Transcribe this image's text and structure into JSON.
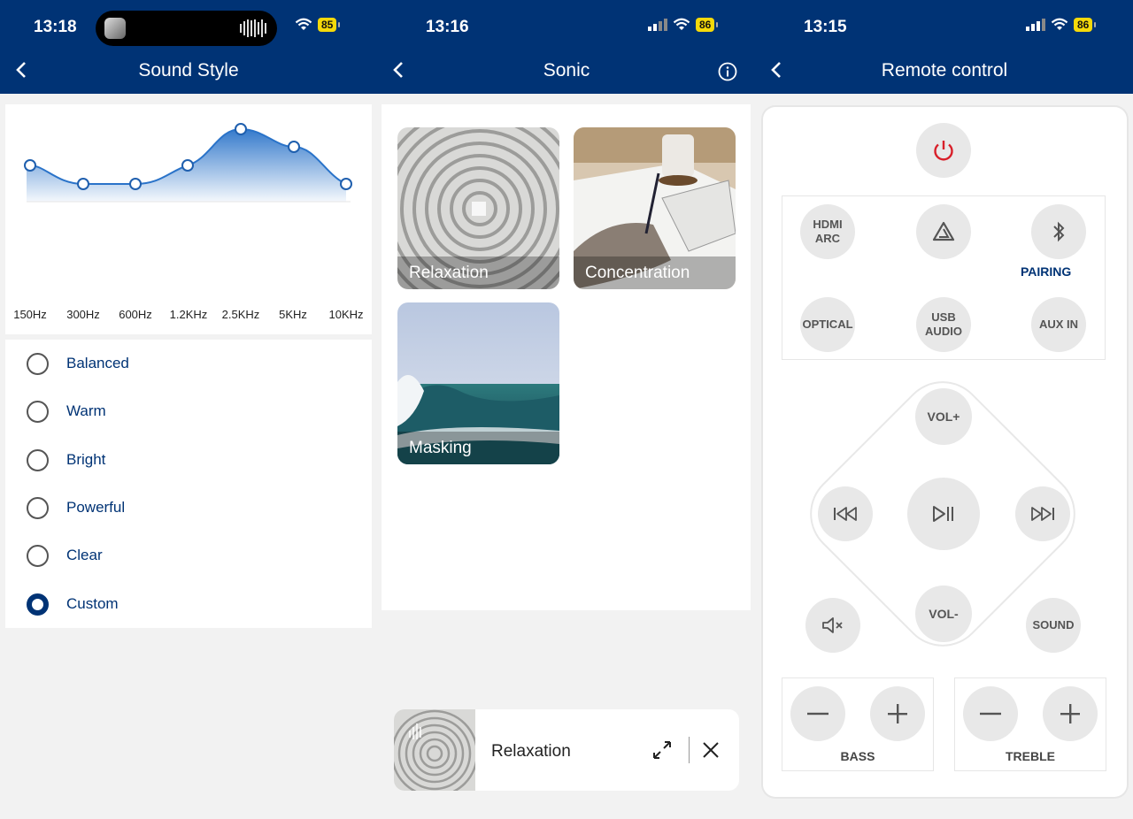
{
  "screens": {
    "sound_style": {
      "status": {
        "time": "13:18",
        "battery": "85"
      },
      "title": "Sound Style",
      "eq": {
        "bands": [
          "150Hz",
          "300Hz",
          "600Hz",
          "1.2KHz",
          "2.5KHz",
          "5KHz",
          "10KHz"
        ]
      },
      "styles": [
        {
          "label": "Balanced",
          "selected": false
        },
        {
          "label": "Warm",
          "selected": false
        },
        {
          "label": "Bright",
          "selected": false
        },
        {
          "label": "Powerful",
          "selected": false
        },
        {
          "label": "Clear",
          "selected": false
        },
        {
          "label": "Custom",
          "selected": true
        }
      ]
    },
    "sonic": {
      "status": {
        "time": "13:16",
        "battery": "86"
      },
      "title": "Sonic",
      "tiles": [
        {
          "label": "Relaxation"
        },
        {
          "label": "Concentration"
        },
        {
          "label": "Masking"
        }
      ],
      "player": {
        "title": "Relaxation"
      }
    },
    "remote": {
      "status": {
        "time": "13:15",
        "battery": "86"
      },
      "title": "Remote control",
      "sources": {
        "hdmi": "HDMI\nARC",
        "pairing": "PAIRING",
        "optical": "OPTICAL",
        "usb": "USB\nAUDIO",
        "aux": "AUX IN"
      },
      "controls": {
        "vol_up": "VOL+",
        "vol_down": "VOL-",
        "sound": "SOUND"
      },
      "tone": {
        "bass": "BASS",
        "treble": "TREBLE"
      }
    }
  },
  "colors": {
    "brand": "#003375",
    "accent_eq": "#2a73c9",
    "power": "#d8202a",
    "battery": "#f5d90a"
  }
}
